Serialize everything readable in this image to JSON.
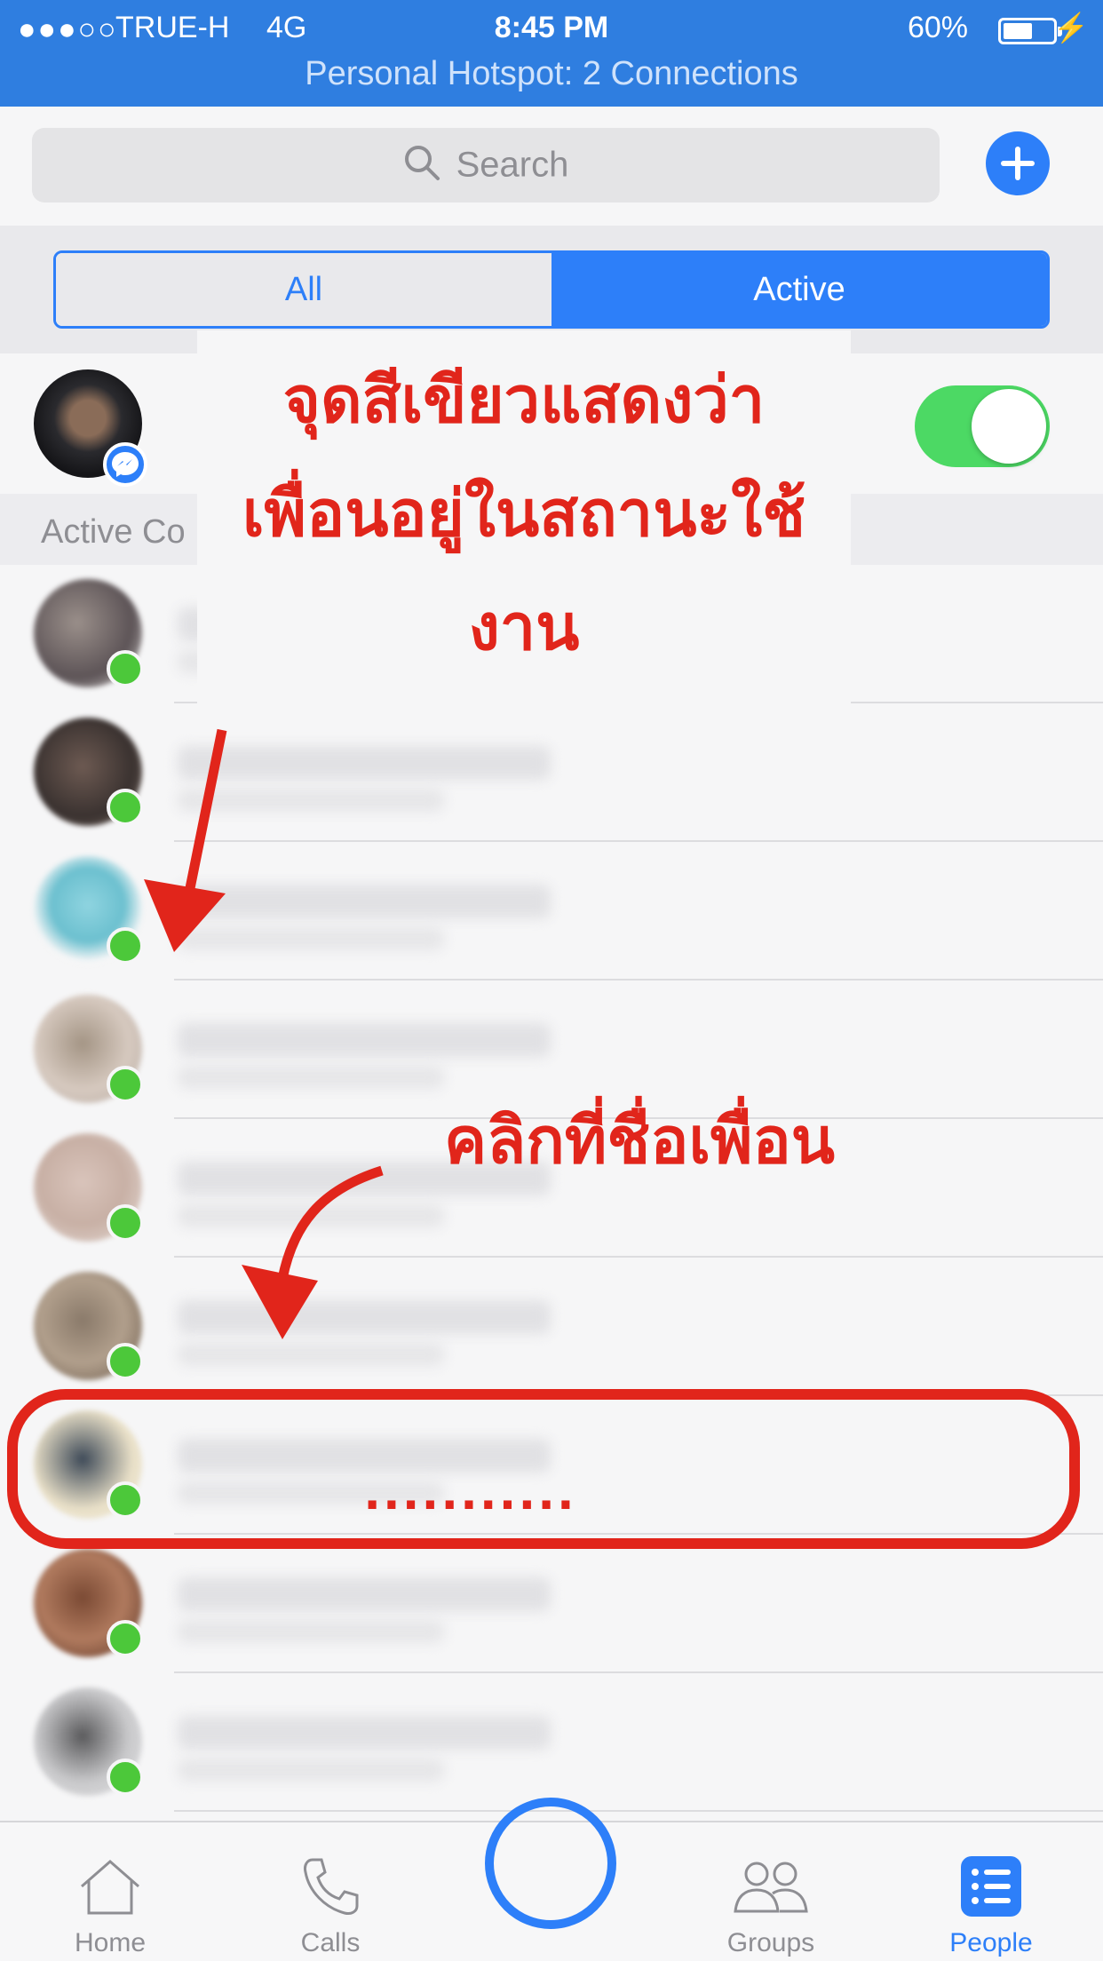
{
  "status_bar": {
    "signal": "●●●○○",
    "carrier": "TRUE-H",
    "network": "4G",
    "time": "8:45 PM",
    "battery_percent": "60%",
    "battery_level": 0.6,
    "hotspot": "Personal Hotspot: 2 Connections"
  },
  "search": {
    "placeholder": "Search"
  },
  "tabs": {
    "all_label": "All",
    "active_label": "Active",
    "selected": "Active"
  },
  "me": {
    "active_status_on": true
  },
  "section": {
    "header_visible": "Active Co"
  },
  "contacts": [
    {
      "online": true
    },
    {
      "online": true
    },
    {
      "online": true
    },
    {
      "online": true
    },
    {
      "online": true
    },
    {
      "online": true
    },
    {
      "online": true
    },
    {
      "online": true
    },
    {
      "online": true
    }
  ],
  "annotations": {
    "green_dot_note_line1": "จุดสีเขียวแสดงว่า",
    "green_dot_note_line2": "เพื่อนอยู่ในสถานะใช้",
    "green_dot_note_line3": "งาน",
    "click_note": "คลิกที่ชื่อเพื่อน",
    "highlight_label": "..........."
  },
  "tab_bar": {
    "home": "Home",
    "calls": "Calls",
    "groups": "Groups",
    "people": "People"
  },
  "colors": {
    "accent": "#2d7ff9",
    "status_bar": "#2f7ee0",
    "online": "#4cc83a",
    "annotation": "#e1251b",
    "toggle_on": "#4cd964"
  }
}
